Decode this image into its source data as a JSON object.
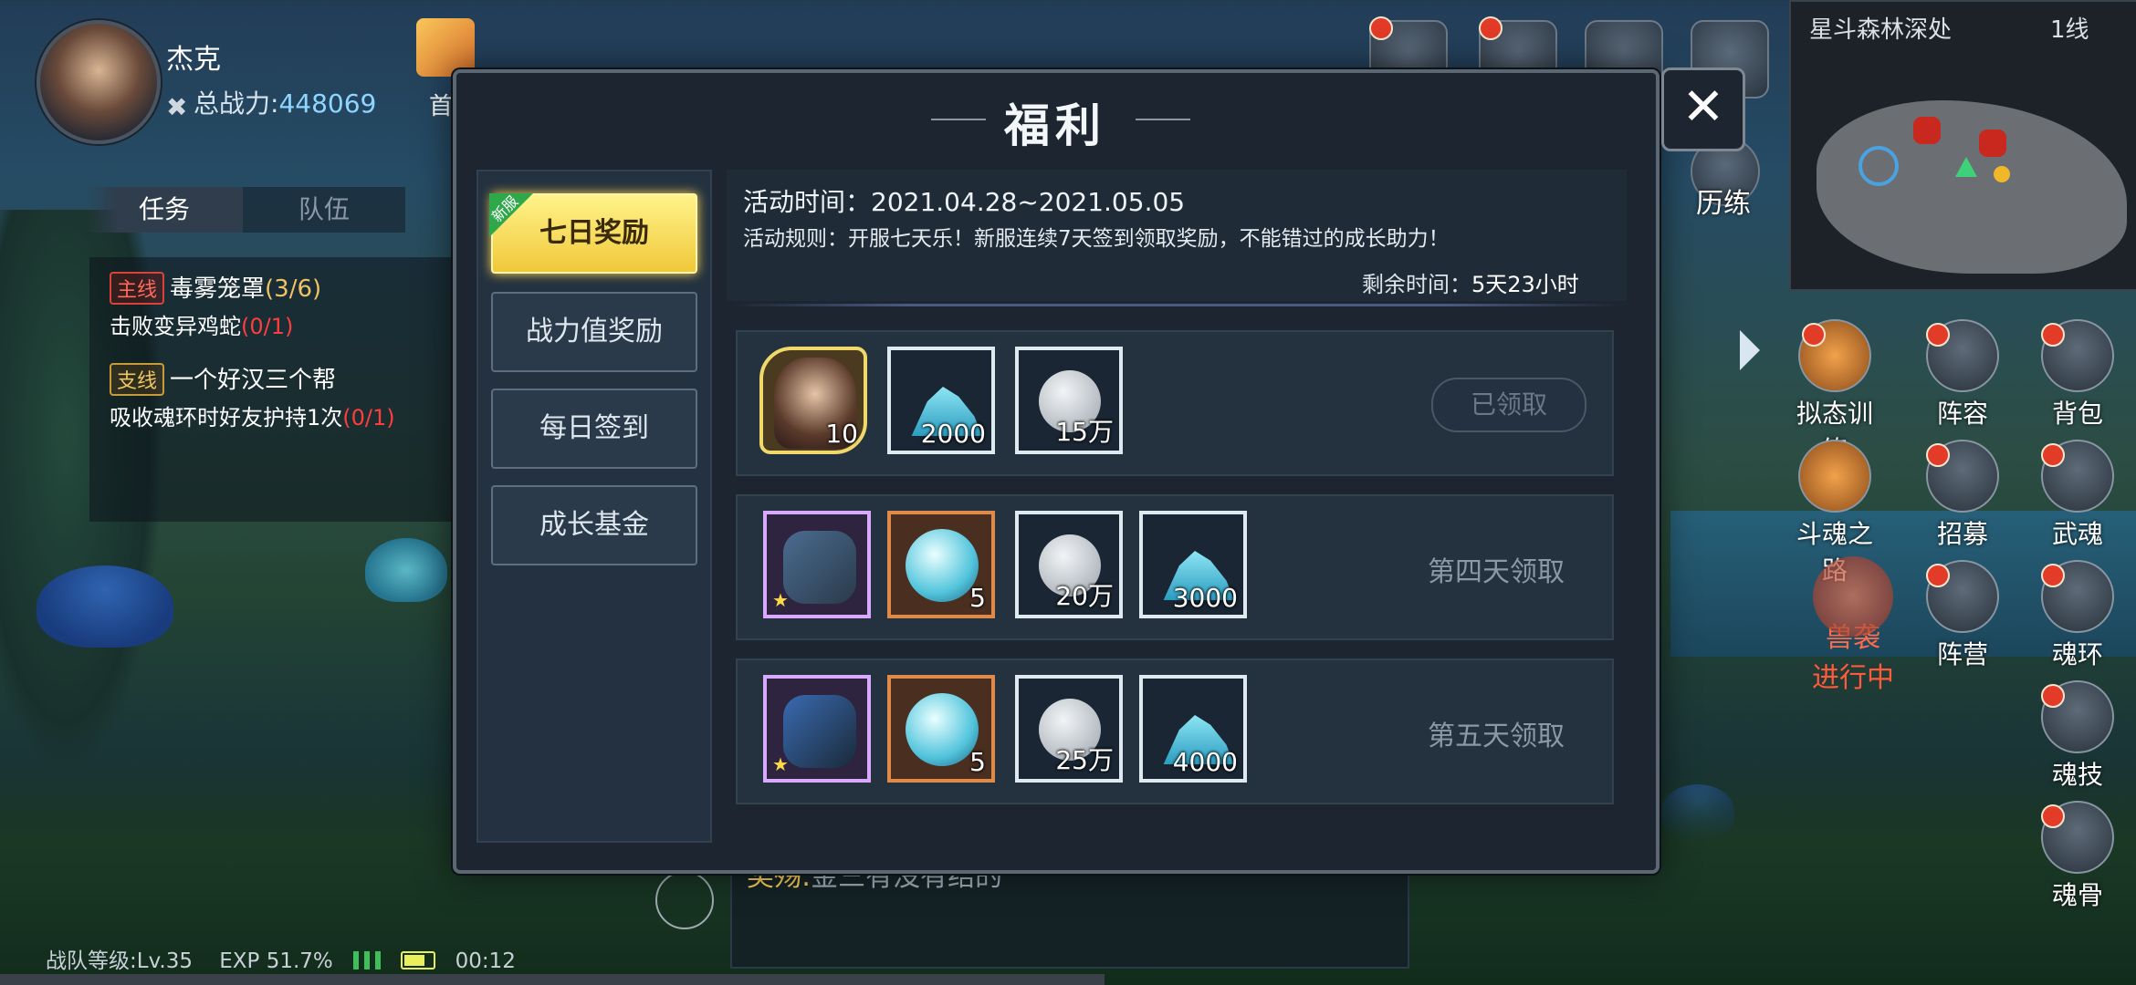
{
  "player": {
    "name": "杰克",
    "power_label": "总战力:",
    "power_value": "448069"
  },
  "gift_label": "首",
  "quest_tabs": [
    "任务",
    "队伍"
  ],
  "quests": [
    {
      "tag": "主线",
      "title": "毒雾笼罩",
      "progress": "(3/6)",
      "desc": "击败变异鸡蛇",
      "desc_progress": "(0/1)"
    },
    {
      "tag": "支线",
      "title": "一个好汉三个帮",
      "desc": "吸收魂环时好友护持1次",
      "desc_progress": "(0/1)"
    }
  ],
  "minimap": {
    "location": "星斗森林深处",
    "line": "1线"
  },
  "top_icons": {
    "training": "历练"
  },
  "side_buttons": [
    {
      "label": "拟态训练"
    },
    {
      "label": "阵容"
    },
    {
      "label": "背包"
    },
    {
      "label": "斗魂之路"
    },
    {
      "label": "招募"
    },
    {
      "label": "武魂"
    },
    {
      "label": "阵营"
    },
    {
      "label": "魂环"
    },
    {
      "label": "魂技"
    },
    {
      "label": "魂骨"
    }
  ],
  "raid": {
    "line1": "兽袭",
    "line2": "进行中"
  },
  "dialog": {
    "title": "福利",
    "close": "✕",
    "nav": [
      {
        "label": "七日奖励",
        "badge": "新服"
      },
      {
        "label": "战力值奖励"
      },
      {
        "label": "每日签到"
      },
      {
        "label": "成长基金"
      }
    ],
    "activity_time": "活动时间：2021.04.28~2021.05.05",
    "activity_rule": "活动规则：开服七天乐！新服连续7天签到领取奖励，不能错过的成长助力！",
    "remaining_label": "剩余时间：",
    "remaining_value": "5天23小时",
    "rows": [
      {
        "status": "已领取",
        "items": [
          "10",
          "2000",
          "15万"
        ]
      },
      {
        "status": "第四天领取",
        "items": [
          "",
          "5",
          "20万",
          "3000"
        ]
      },
      {
        "status": "第五天领取",
        "items": [
          "",
          "5",
          "25万",
          "4000"
        ]
      }
    ]
  },
  "chat": {
    "tag": "奖殇:",
    "text": "金三有没有结的"
  },
  "status_bar": {
    "level": "战队等级:Lv.35",
    "exp": "EXP 51.7%",
    "time": "00:12"
  },
  "colors": {
    "accent_gold": "#f0c83a",
    "alert_red": "#e23b28",
    "link_blue": "#8fd6ff"
  }
}
